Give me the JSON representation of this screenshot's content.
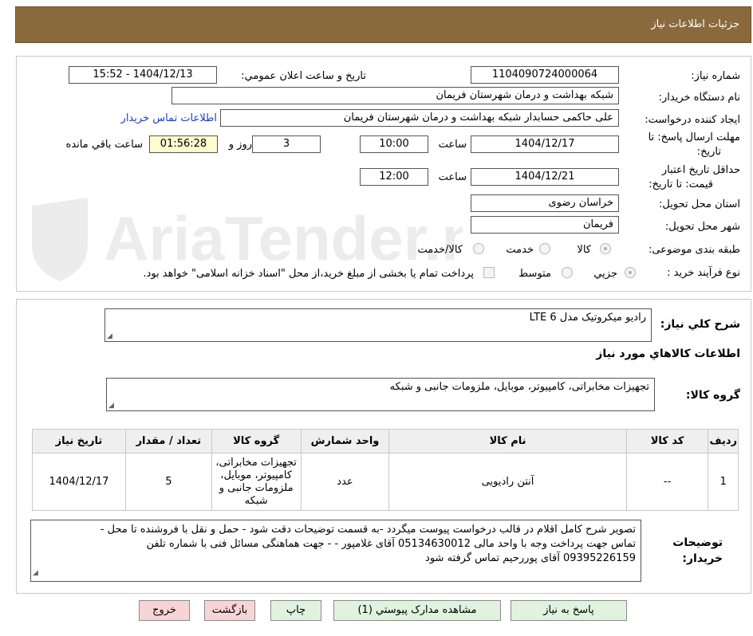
{
  "header": {
    "title": "جزئیات اطلاعات نیاز"
  },
  "watermark": {
    "text": "AriaTender.neT"
  },
  "fields": {
    "need_number_label": "شماره نیاز:",
    "need_number": "1104090724000064",
    "announce_label": "تاریخ و ساعت اعلان عمومي:",
    "announce_value": "1404/12/13 - 15:52",
    "buyer_org_label": "نام دستگاه خریدار:",
    "buyer_org": "شبکه بهداشت و درمان شهرستان فریمان",
    "requester_label": "ایجاد کننده درخواست:",
    "requester": "علی حاکمی حسابدار شبکه بهداشت و درمان شهرستان فریمان",
    "contact_link": "اطلاعات تماس خریدار",
    "deadline_label_1": "مهلت ارسال پاسخ: تا",
    "deadline_label_2": "تاریخ:",
    "deadline_date": "1404/12/17",
    "time_label": "ساعت",
    "deadline_time": "10:00",
    "days_value": "3",
    "days_label": "روز و",
    "remaining_time": "01:56:28",
    "remaining_label": "ساعت باقي مانده",
    "validity_label_1": "حداقل تاریخ اعتبار",
    "validity_label_2": "قیمت: تا تاریخ:",
    "validity_date": "1404/12/21",
    "validity_time": "12:00",
    "province_label": "استان محل تحویل:",
    "province": "خراسان رضوی",
    "city_label": "شهر محل تحویل:",
    "city": "فریمان",
    "category_label": "طبقه بندی موضوعی:",
    "category_options": [
      "کالا",
      "خدمت",
      "کالا/خدمت"
    ],
    "process_label": "نوع فرآیند خرید :",
    "process_options": [
      "جزیي",
      "متوسط"
    ],
    "process_note": "پرداخت تمام یا بخشی از مبلغ خرید،از محل \"اسناد خزانه اسلامی\" خواهد بود."
  },
  "summary": {
    "label": "شرح کلي نیاز:",
    "value": "رادیو میکروتیک مدل LTE 6"
  },
  "goods_info_title": "اطلاعات کالاهاي مورد نیاز",
  "goods_group": {
    "label": "گروه کالا:",
    "value": "تجهیزات مخابراتی، کامپیوتر، موبایل، ملزومات جانبی و شبکه"
  },
  "table": {
    "headers": [
      "ردیف",
      "کد کالا",
      "نام کالا",
      "واحد شمارش",
      "گروه کالا",
      "تعداد / مقدار",
      "تاریخ نیاز"
    ],
    "rows": [
      [
        "1",
        "--",
        "آنتن رادیویی",
        "عدد",
        "تجهیزات مخابراتی، کامپیوتر، موبایل، ملزومات جانبی و شبکه",
        "5",
        "1404/12/17"
      ]
    ]
  },
  "notes": {
    "label_1": "توضیحات",
    "label_2": "خریدار:",
    "line1": "تصویر شرح کامل اقلام در قالب درخواست پیوست میگردد -به قسمت توضیحات دقت شود - حمل و نقل با فروشنده تا محل  -",
    "line2": "تماس جهت پرداخت وجه با واحد مالی 05134630012 آقای غلامپور  -  - جهت هماهنگی مسائل فنی با شماره تلفن",
    "line3": "09395226159 آقای پوررحیم تماس گرفته شود"
  },
  "buttons": {
    "reply": "پاسخ به نیاز",
    "attachments": "مشاهده مدارک پیوستي (1)",
    "print": "چاپ",
    "back": "بازگشت",
    "exit": "خروج"
  }
}
